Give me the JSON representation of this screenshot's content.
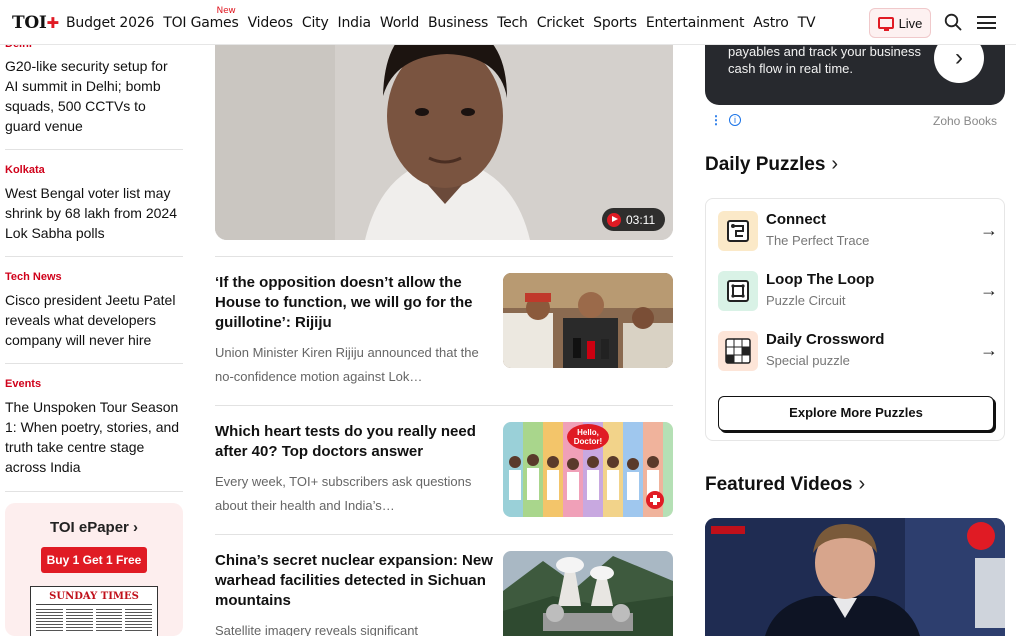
{
  "nav": {
    "logo_text": "TOI",
    "logo_plus": "✚",
    "links": [
      "Budget 2026",
      "TOI Games",
      "Videos",
      "City",
      "India",
      "World",
      "Business",
      "Tech",
      "Cricket",
      "Sports",
      "Entertainment",
      "Astro",
      "TV"
    ],
    "new_badge": "New",
    "live_label": "Live"
  },
  "left": {
    "items": [
      {
        "category": "Delhi",
        "title": "G20-like security setup for AI summit in Delhi; bomb squads, 500 CCTVs to guard venue"
      },
      {
        "category": "Kolkata",
        "title": "West Bengal voter list may shrink by 68 lakh from 2024 Lok Sabha polls"
      },
      {
        "category": "Tech News",
        "title": "Cisco president Jeetu Patel reveals what developers company will never hire"
      },
      {
        "category": "Events",
        "title": "The Unspoken Tour Season 1: When poetry, stories, and truth take centre stage across India"
      }
    ],
    "epaper": {
      "title": "TOI ePaper ›",
      "offer": "Buy 1 Get 1 Free",
      "masthead": "SUNDAY TIMES"
    }
  },
  "center": {
    "hero_duration": "03:11",
    "stories": [
      {
        "title": "‘If the opposition doesn’t allow the House to function, we will go for the guillotine’: Rijiju",
        "summary": "Union Minister Kiren Rijiju announced that the no-confidence motion against Lok…"
      },
      {
        "title": "Which heart tests do you really need after 40? Top doctors answer",
        "summary": "Every week, TOI+ subscribers ask questions about their health and India’s…",
        "image_badge": "Hello, Doctor!"
      },
      {
        "title": "China’s secret nuclear expansion: New warhead facilities detected in Sichuan mountains",
        "summary": "Satellite imagery reveals significant"
      }
    ]
  },
  "right": {
    "ad_text": "payables and track your business cash flow in real time.",
    "ad_brand": "Zoho Books",
    "ad_info": "i",
    "puzzles_heading": "Daily Puzzles",
    "puzzles": [
      {
        "name": "Connect",
        "subtitle": "The Perfect Trace"
      },
      {
        "name": "Loop The Loop",
        "subtitle": "Puzzle Circuit"
      },
      {
        "name": "Daily Crossword",
        "subtitle": "Special puzzle"
      }
    ],
    "explore_label": "Explore More Puzzles",
    "videos_heading": "Featured Videos"
  }
}
